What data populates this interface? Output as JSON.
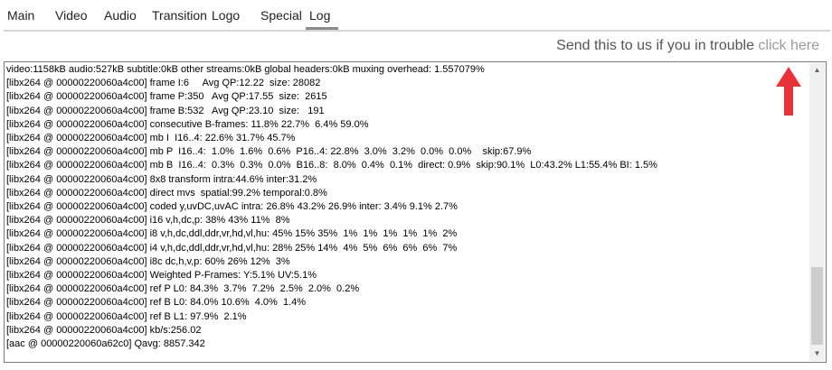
{
  "tabs": [
    {
      "label": "Main"
    },
    {
      "label": "Video"
    },
    {
      "label": "Audio"
    },
    {
      "label": "Transition"
    },
    {
      "label": "Logo"
    },
    {
      "label": "Special"
    },
    {
      "label": "Log",
      "active": true
    }
  ],
  "trouble": {
    "message": "Send this to us if you in trouble",
    "link": "click here"
  },
  "arrow_icon": "red-up-arrow-icon",
  "colors": {
    "arrow": "#e8333a",
    "link": "#9a9a9a"
  },
  "log": {
    "lines": [
      "video:1158kB audio:527kB subtitle:0kB other streams:0kB global headers:0kB muxing overhead: 1.557079%",
      "[libx264 @ 00000220060a4c00] frame I:6     Avg QP:12.22  size: 28082",
      "[libx264 @ 00000220060a4c00] frame P:350   Avg QP:17.55  size:  2615",
      "[libx264 @ 00000220060a4c00] frame B:532   Avg QP:23.10  size:   191",
      "[libx264 @ 00000220060a4c00] consecutive B-frames: 11.8% 22.7%  6.4% 59.0%",
      "[libx264 @ 00000220060a4c00] mb I  I16..4: 22.6% 31.7% 45.7%",
      "[libx264 @ 00000220060a4c00] mb P  I16..4:  1.0%  1.6%  0.6%  P16..4: 22.8%  3.0%  3.2%  0.0%  0.0%    skip:67.9%",
      "[libx264 @ 00000220060a4c00] mb B  I16..4:  0.3%  0.3%  0.0%  B16..8:  8.0%  0.4%  0.1%  direct: 0.9%  skip:90.1%  L0:43.2% L1:55.4% BI: 1.5%",
      "[libx264 @ 00000220060a4c00] 8x8 transform intra:44.6% inter:31.2%",
      "[libx264 @ 00000220060a4c00] direct mvs  spatial:99.2% temporal:0.8%",
      "[libx264 @ 00000220060a4c00] coded y,uvDC,uvAC intra: 26.8% 43.2% 26.9% inter: 3.4% 9.1% 2.7%",
      "[libx264 @ 00000220060a4c00] i16 v,h,dc,p: 38% 43% 11%  8%",
      "[libx264 @ 00000220060a4c00] i8 v,h,dc,ddl,ddr,vr,hd,vl,hu: 45% 15% 35%  1%  1%  1%  1%  1%  2%",
      "[libx264 @ 00000220060a4c00] i4 v,h,dc,ddl,ddr,vr,hd,vl,hu: 28% 25% 14%  4%  5%  6%  6%  6%  7%",
      "[libx264 @ 00000220060a4c00] i8c dc,h,v,p: 60% 26% 12%  3%",
      "[libx264 @ 00000220060a4c00] Weighted P-Frames: Y:5.1% UV:5.1%",
      "[libx264 @ 00000220060a4c00] ref P L0: 84.3%  3.7%  7.2%  2.5%  2.0%  0.2%",
      "[libx264 @ 00000220060a4c00] ref B L0: 84.0% 10.6%  4.0%  1.4%",
      "[libx264 @ 00000220060a4c00] ref B L1: 97.9%  2.1%",
      "[libx264 @ 00000220060a4c00] kb/s:256.02",
      "[aac @ 00000220060a62c0] Qavg: 8857.342"
    ]
  }
}
